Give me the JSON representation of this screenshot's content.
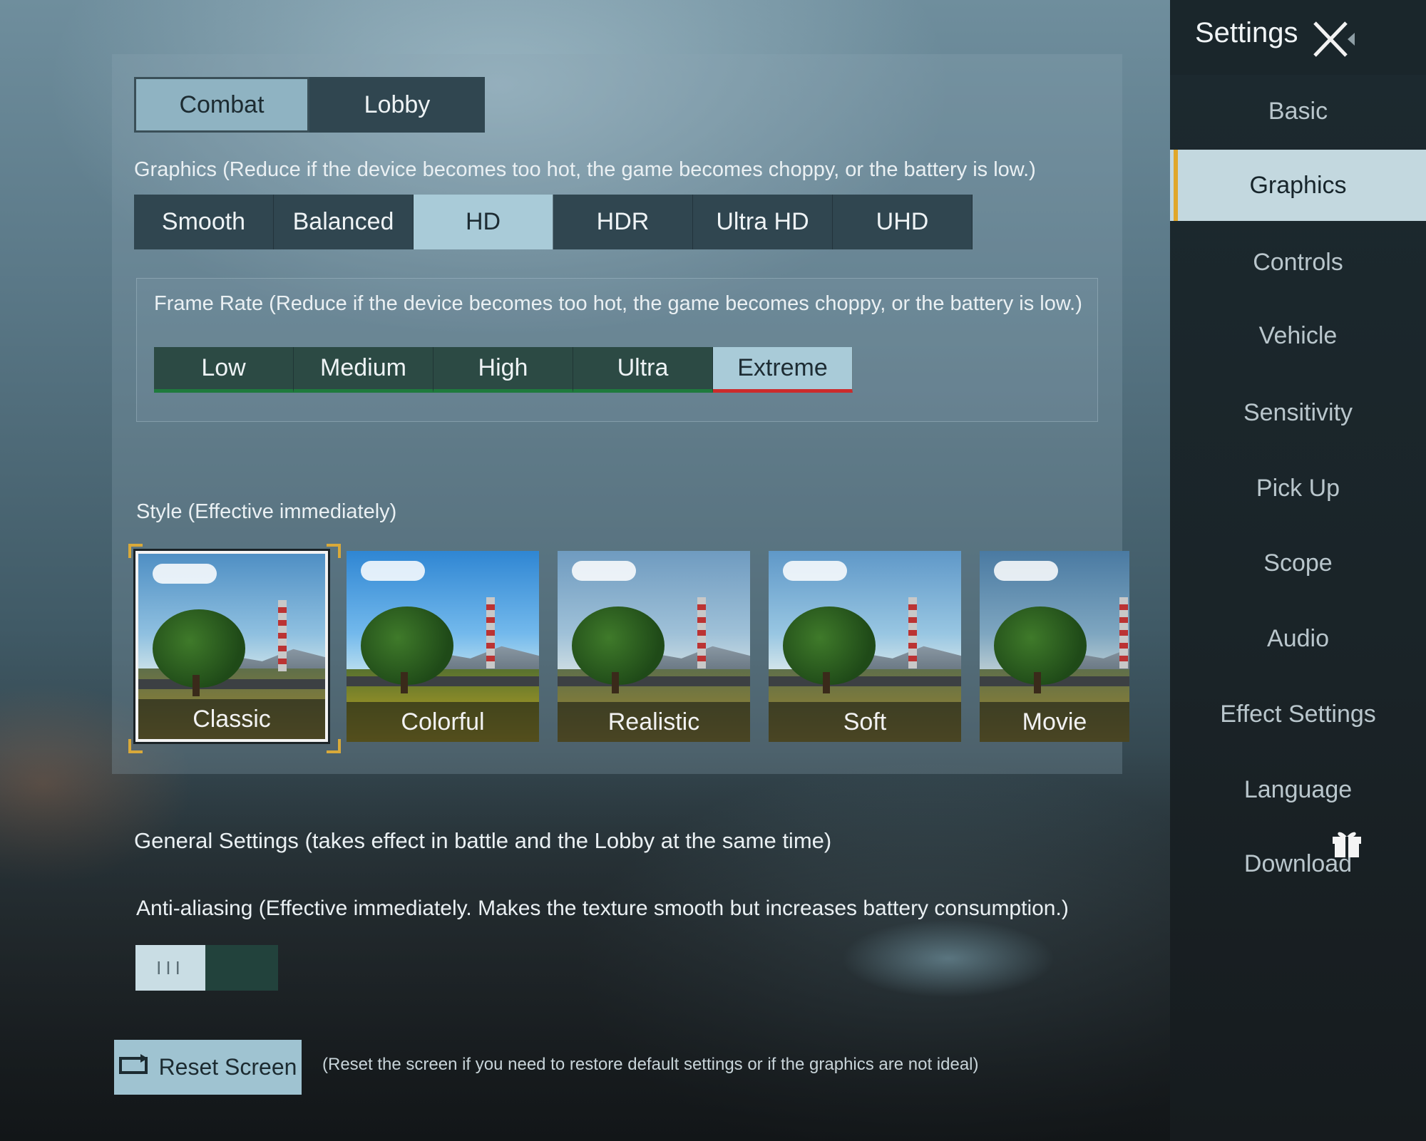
{
  "sidebar": {
    "title": "Settings",
    "items": [
      {
        "label": "Basic"
      },
      {
        "label": "Graphics",
        "active": true
      },
      {
        "label": "Controls"
      },
      {
        "label": "Vehicle"
      },
      {
        "label": "Sensitivity"
      },
      {
        "label": "Pick Up"
      },
      {
        "label": "Scope"
      },
      {
        "label": "Audio"
      },
      {
        "label": "Effect Settings"
      },
      {
        "label": "Language"
      },
      {
        "label": "Download"
      }
    ]
  },
  "mode_tabs": [
    {
      "label": "Combat",
      "active": true
    },
    {
      "label": "Lobby",
      "active": false
    }
  ],
  "graphics": {
    "label": "Graphics (Reduce if the device becomes too hot, the game becomes choppy, or the battery is low.)",
    "options": [
      "Smooth",
      "Balanced",
      "HD",
      "HDR",
      "Ultra HD",
      "UHD"
    ],
    "selected": "HD"
  },
  "frame_rate": {
    "label": "Frame Rate (Reduce if the device becomes too hot, the game becomes choppy, or the battery is low.)",
    "options": [
      "Low",
      "Medium",
      "High",
      "Ultra",
      "Extreme"
    ],
    "selected": "Extreme"
  },
  "style": {
    "label": "Style (Effective immediately)",
    "options": [
      "Classic",
      "Colorful",
      "Realistic",
      "Soft",
      "Movie"
    ],
    "selected": "Classic"
  },
  "general": {
    "label": "General Settings (takes effect in battle and the Lobby at the same time)"
  },
  "anti_aliasing": {
    "label": "Anti-aliasing (Effective immediately. Makes the texture smooth but increases battery consumption.)",
    "knob_glyph": "III",
    "enabled": false
  },
  "reset": {
    "label": "Reset Screen",
    "hint": "(Reset the screen if you need to restore default settings or if the graphics are not ideal)"
  },
  "colors": {
    "accent": "#e0a72a",
    "selected_option": "#a9cbd8",
    "fps_underline": "#1f7a3d",
    "fps_selected_underline": "#cc2b2b"
  }
}
